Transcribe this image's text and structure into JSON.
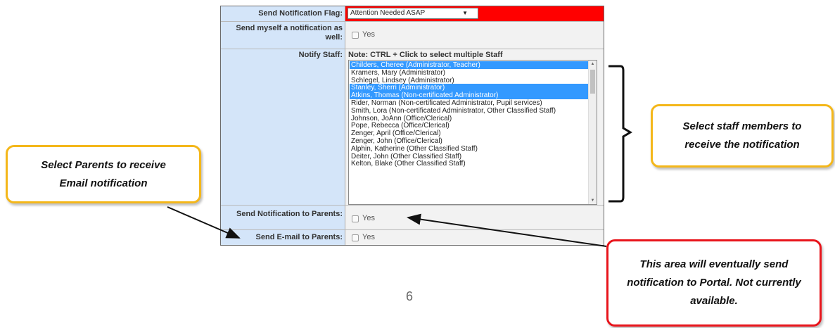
{
  "form": {
    "flag": {
      "label": "Send Notification Flag:",
      "selected": "Attention Needed ASAP",
      "accent_color": "#ff0000"
    },
    "self_notify": {
      "label": "Send myself a notification as well:",
      "option": "Yes"
    },
    "notify_staff": {
      "label": "Notify Staff:",
      "note": "Note: CTRL + Click to select multiple Staff",
      "items": [
        {
          "name": "Childers, Cheree (Administrator, Teacher)",
          "selected": true
        },
        {
          "name": "Kramers, Mary (Administrator)",
          "selected": false
        },
        {
          "name": "Schlegel, Lindsey (Administrator)",
          "selected": false
        },
        {
          "name": "Stanley, Sherri (Administrator)",
          "selected": true
        },
        {
          "name": "Atkins, Thomas (Non-certificated Administrator)",
          "selected": true
        },
        {
          "name": "Rider, Norman (Non-certificated Administrator, Pupil services)",
          "selected": false
        },
        {
          "name": "Smith, Lora (Non-certificated Administrator, Other Classified Staff)",
          "selected": false
        },
        {
          "name": "Johnson, JoAnn (Office/Clerical)",
          "selected": false
        },
        {
          "name": "Pope, Rebecca (Office/Clerical)",
          "selected": false
        },
        {
          "name": "Zenger, April (Office/Clerical)",
          "selected": false
        },
        {
          "name": "Zenger, John (Office/Clerical)",
          "selected": false
        },
        {
          "name": "Alphin, Katherine (Other Classified Staff)",
          "selected": false
        },
        {
          "name": "Deiter, John (Other Classified Staff)",
          "selected": false
        },
        {
          "name": "Kelton, Blake (Other Classified Staff)",
          "selected": false
        }
      ],
      "selection_color": "#3399ff"
    },
    "notify_parents": {
      "label": "Send Notification to Parents:",
      "option": "Yes"
    },
    "email_parents": {
      "label": "Send E-mail to Parents:",
      "option": "Yes"
    }
  },
  "callouts": {
    "staff": "Select staff members to receive the notification",
    "parents": "Select Parents to receive Email notification",
    "portal": "This area will eventually send notification to Portal. Not currently available."
  },
  "page_number": "6",
  "colors": {
    "label_bg": "#d4e5f9",
    "callout_yellow": "#f4b71a",
    "callout_red": "#e8141b"
  }
}
